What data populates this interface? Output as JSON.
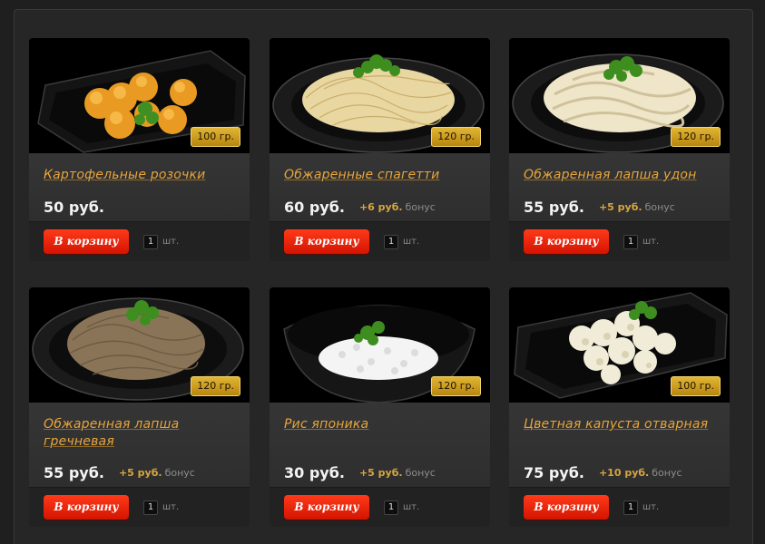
{
  "products": [
    {
      "title": "Картофельные розочки",
      "weight": "100 гр.",
      "price": "50 руб.",
      "bonus": "",
      "bonus_word": "",
      "cart_label": "В корзину",
      "qty": "1",
      "unit": "шт.",
      "dish": "potato-roses"
    },
    {
      "title": "Обжаренные спагетти",
      "weight": "120 гр.",
      "price": "60 руб.",
      "bonus": "+6 руб.",
      "bonus_word": "бонус",
      "cart_label": "В корзину",
      "qty": "1",
      "unit": "шт.",
      "dish": "spaghetti"
    },
    {
      "title": "Обжаренная лапша удон",
      "weight": "120 гр.",
      "price": "55 руб.",
      "bonus": "+5 руб.",
      "bonus_word": "бонус",
      "cart_label": "В корзину",
      "qty": "1",
      "unit": "шт.",
      "dish": "udon"
    },
    {
      "title": "Обжаренная лапша гречневая",
      "weight": "120 гр.",
      "price": "55 руб.",
      "bonus": "+5 руб.",
      "bonus_word": "бонус",
      "cart_label": "В корзину",
      "qty": "1",
      "unit": "шт.",
      "dish": "soba"
    },
    {
      "title": "Рис японика",
      "weight": "120 гр.",
      "price": "30 руб.",
      "bonus": "+5 руб.",
      "bonus_word": "бонус",
      "cart_label": "В корзину",
      "qty": "1",
      "unit": "шт.",
      "dish": "rice"
    },
    {
      "title": "Цветная капуста отварная",
      "weight": "100 гр.",
      "price": "75 руб.",
      "bonus": "+10 руб.",
      "bonus_word": "бонус",
      "cart_label": "В корзину",
      "qty": "1",
      "unit": "шт.",
      "dish": "cauliflower"
    }
  ],
  "colors": {
    "title": "#e8a53b",
    "button": "#e81e05",
    "badge": "#d4a11f",
    "background": "#1f1f1f"
  }
}
